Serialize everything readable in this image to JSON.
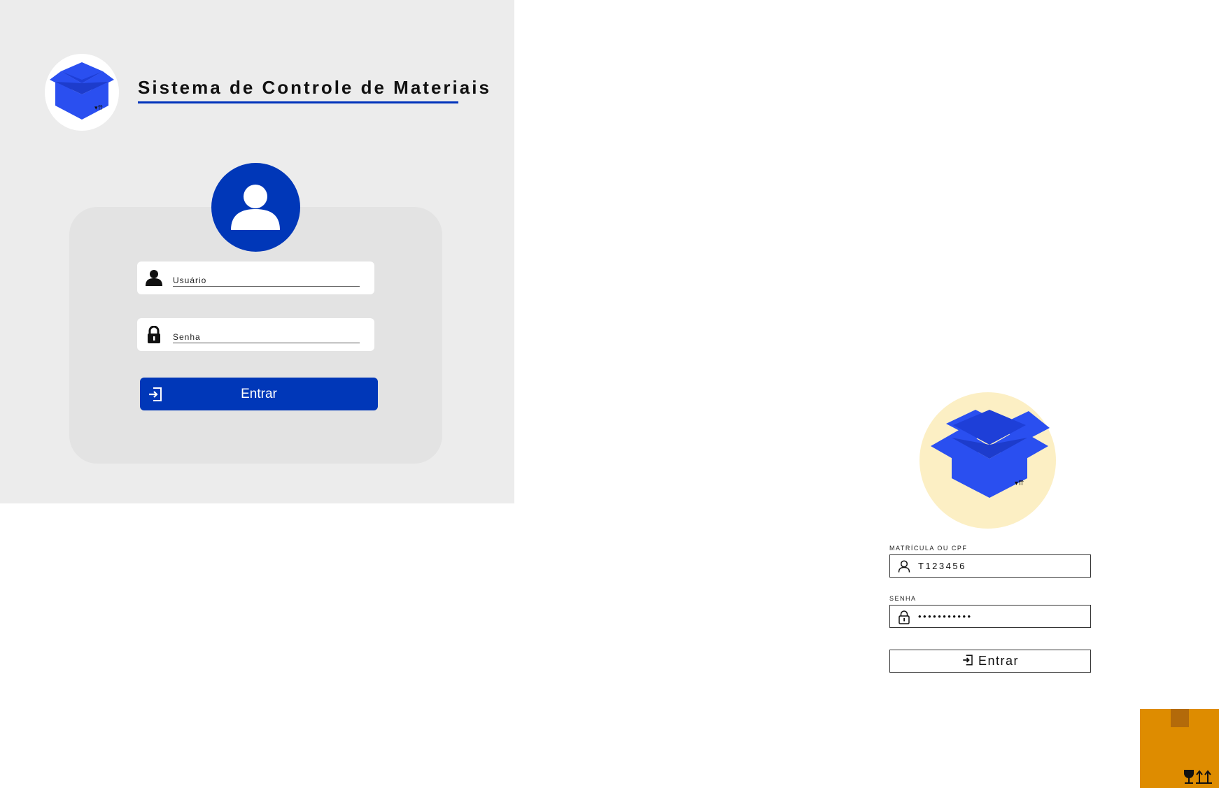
{
  "app": {
    "title": "Sistema de Controle de Materiais"
  },
  "login_form_1": {
    "username_label": "Usuário",
    "password_label": "Senha",
    "submit_label": "Entrar"
  },
  "login_form_2": {
    "id_label": "MATRÍCULA OU CPF",
    "id_value": "T123456",
    "password_label": "SENHA",
    "password_value": "•••••••••••",
    "submit_label": "Entrar"
  },
  "icons": {
    "logo": "open-box-icon",
    "avatar": "user-icon",
    "username": "user-icon",
    "password": "lock-icon",
    "submit": "login-icon",
    "package": "package-box-icon"
  },
  "colors": {
    "primary_blue": "#0037b8",
    "box_blue": "#2a4ff0",
    "logo_bg": "#fcefc4",
    "box_orange": "#de8c00"
  }
}
